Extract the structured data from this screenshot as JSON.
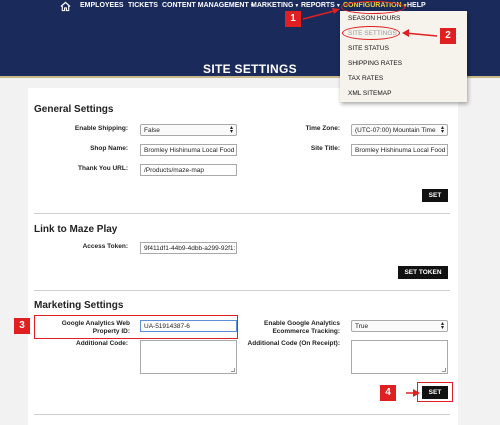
{
  "nav": {
    "items": [
      "EMPLOYEES",
      "TICKETS",
      "CONTENT MANAGEMENT",
      "MARKETING",
      "REPORTS",
      "CONFIGURATION",
      "HELP"
    ]
  },
  "header": {
    "title": "SITE SETTINGS"
  },
  "dropdown": {
    "items": [
      "SEASON HOURS",
      "SITE SETTINGS",
      "SITE STATUS",
      "SHIPPING RATES",
      "TAX RATES",
      "XML SITEMAP"
    ],
    "active": "SITE SETTINGS"
  },
  "general": {
    "title": "General Settings",
    "enable_shipping_label": "Enable Shipping:",
    "enable_shipping_value": "False",
    "shop_name_label": "Shop Name:",
    "shop_name_value": "Bromley Hishinuma Local Food",
    "thank_you_label": "Thank You URL:",
    "thank_you_value": "/Products/maze-map",
    "time_zone_label": "Time Zone:",
    "time_zone_value": "(UTC-07:00) Mountain Time",
    "site_title_label": "Site Title:",
    "site_title_value": "Bromley Hishinuma Local Food",
    "set_label": "SET"
  },
  "maze": {
    "title": "Link to Maze Play",
    "token_label": "Access Token:",
    "token_value": "9f411df1-44b9-4dbb-a299-92f1:",
    "set_token_label": "SET TOKEN"
  },
  "marketing": {
    "title": "Marketing Settings",
    "ga_label": "Google Analytics Web Property ID:",
    "ga_value": "UA-51914387-6",
    "ecommerce_label": "Enable Google Analytics Ecommerce Tracking:",
    "ecommerce_value": "True",
    "additional_label": "Additional Code:",
    "additional_receipt_label": "Additional Code (On Receipt):",
    "set_label": "SET"
  },
  "annotations": {
    "badges": [
      "1",
      "2",
      "3",
      "4"
    ],
    "color": "#e02020"
  }
}
